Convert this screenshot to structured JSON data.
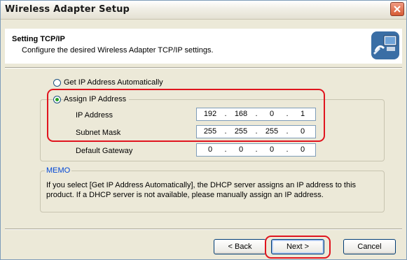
{
  "window": {
    "title": "Wireless Adapter Setup"
  },
  "header": {
    "title": "Setting TCP/IP",
    "subtitle": "Configure the desired Wireless Adapter TCP/IP settings.",
    "icon": "network-computer-icon"
  },
  "options": {
    "auto": {
      "label": "Get IP Address Automatically",
      "selected": false
    },
    "assign": {
      "label": "Assign IP Address",
      "selected": true
    }
  },
  "fields": {
    "ip": {
      "label": "IP Address",
      "octets": [
        "192",
        "168",
        "0",
        "1"
      ]
    },
    "subnet": {
      "label": "Subnet Mask",
      "octets": [
        "255",
        "255",
        "255",
        "0"
      ]
    },
    "gateway": {
      "label": "Default Gateway",
      "octets": [
        "0",
        "0",
        "0",
        "0"
      ]
    }
  },
  "memo": {
    "title": "MEMO",
    "text": "If you select [Get IP Address Automatically], the DHCP server assigns an IP address to this product. If a DHCP server is not available, please manually assign an IP address."
  },
  "buttons": {
    "back": "< Back",
    "next": "Next >",
    "cancel": "Cancel"
  },
  "colors": {
    "highlight": "#e0141e",
    "memo_title": "#0046d5",
    "radio_selected": "#21a121"
  }
}
